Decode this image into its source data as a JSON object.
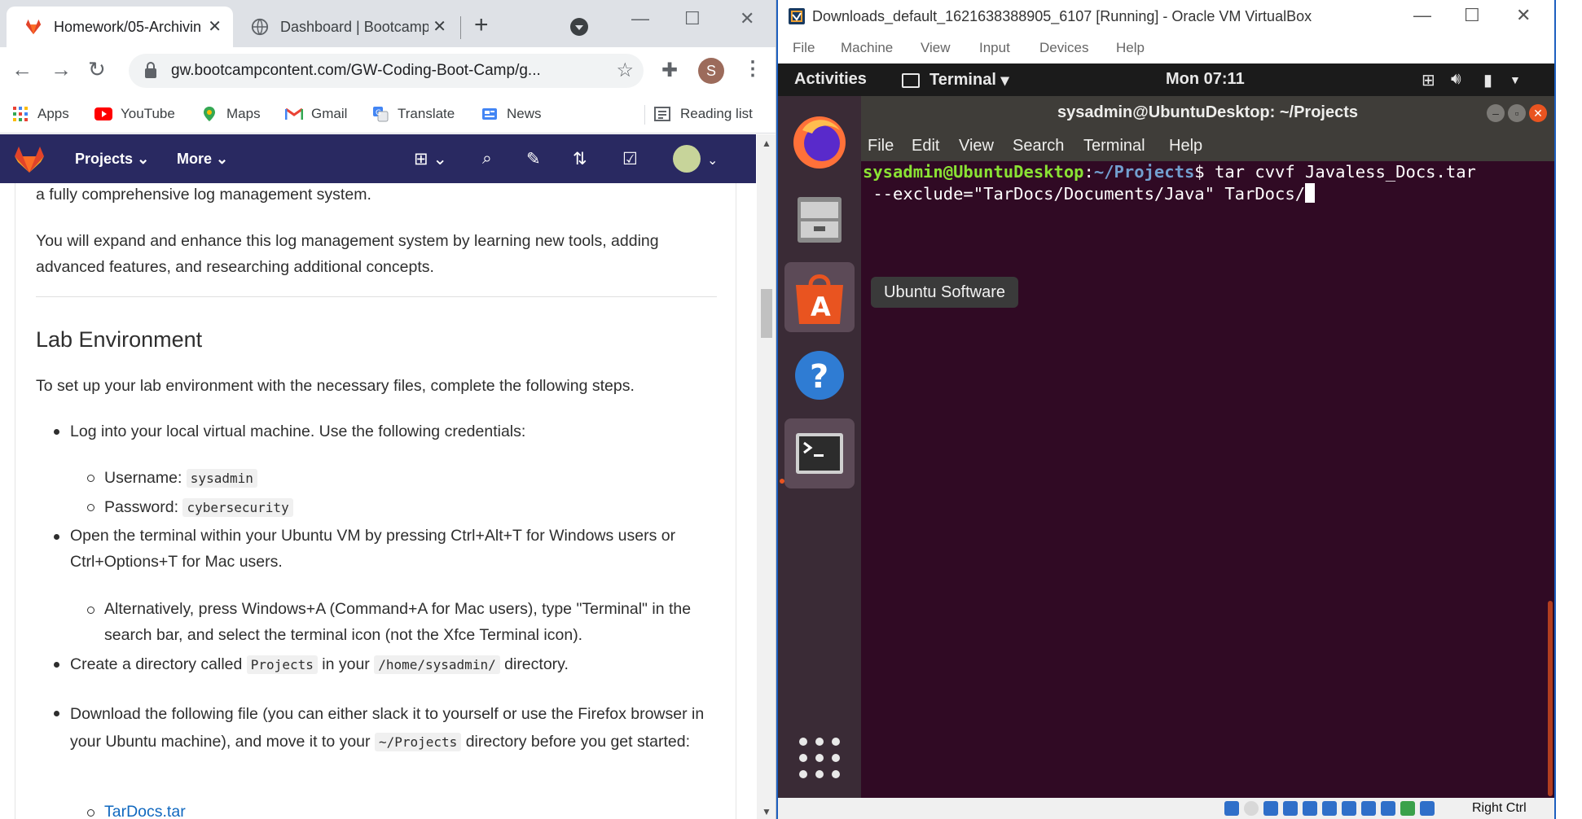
{
  "browser": {
    "tabs": [
      {
        "title": "Homework/05-Archivin"
      },
      {
        "title": "Dashboard | Bootcamp"
      }
    ],
    "url": "gw.bootcampcontent.com/GW-Coding-Boot-Camp/g...",
    "profile_initial": "S",
    "bookmarks": [
      {
        "label": "Apps"
      },
      {
        "label": "YouTube"
      },
      {
        "label": "Maps"
      },
      {
        "label": "Gmail"
      },
      {
        "label": "Translate"
      },
      {
        "label": "News"
      }
    ],
    "reading_list": "Reading list"
  },
  "gitlab_nav": {
    "projects": "Projects",
    "more": "More"
  },
  "article": {
    "intro_line": "a fully comprehensive log management system.",
    "para2": "You will expand and enhance this log management system by learning new tools, adding advanced features, and researching additional concepts.",
    "heading": "Lab Environment",
    "setup": "To set up your lab environment with the necessary files, complete the following steps.",
    "step1": "Log into your local virtual machine. Use the following credentials:",
    "username_label": "Username:",
    "username": "sysadmin",
    "password_label": "Password:",
    "password": "cybersecurity",
    "step2": "Open the terminal within your Ubuntu VM by pressing Ctrl+Alt+T for Windows users or Ctrl+Options+T for Mac users.",
    "step2_alt": "Alternatively, press Windows+A (Command+A for Mac users), type \"Terminal\" in the search bar, and select the terminal icon (not the Xfce Terminal icon).",
    "step3_a": "Create a directory called",
    "step3_code1": "Projects",
    "step3_b": "in your",
    "step3_code2": "/home/sysadmin/",
    "step3_c": "directory.",
    "step4_a": "Download the following file (you can either slack it to yourself or use the Firefox browser in your Ubuntu machine), and move it to your",
    "step4_code": "~/Projects",
    "step4_b": "directory before you get started:",
    "file_link": "TarDocs.tar"
  },
  "vbox": {
    "title": "Downloads_default_1621638388905_6107 [Running] - Oracle VM VirtualBox",
    "menu": [
      "File",
      "Machine",
      "View",
      "Input",
      "Devices",
      "Help"
    ],
    "host_key": "Right Ctrl"
  },
  "ubuntu": {
    "activities": "Activities",
    "app_menu": "Terminal",
    "clock": "Mon 07:11",
    "tooltip": "Ubuntu Software",
    "dock": [
      "firefox-icon",
      "files-icon",
      "ubuntu-software-icon",
      "help-icon",
      "terminal-icon"
    ]
  },
  "terminal": {
    "title": "sysadmin@UbuntuDesktop: ~/Projects",
    "menu": [
      "File",
      "Edit",
      "View",
      "Search",
      "Terminal",
      "Help"
    ],
    "prompt_user": "sysadmin@UbuntuDesktop",
    "prompt_path": "~/Projects",
    "command_line1": "$ tar cvvf Javaless_Docs.tar",
    "command_line2": " --exclude=\"TarDocs/Documents/Java\" TarDocs/"
  },
  "colors": {
    "gitlab_nav": "#292961",
    "ubuntu_orange": "#e95420",
    "terminal_bg": "#300a24",
    "link": "#1068bf"
  }
}
